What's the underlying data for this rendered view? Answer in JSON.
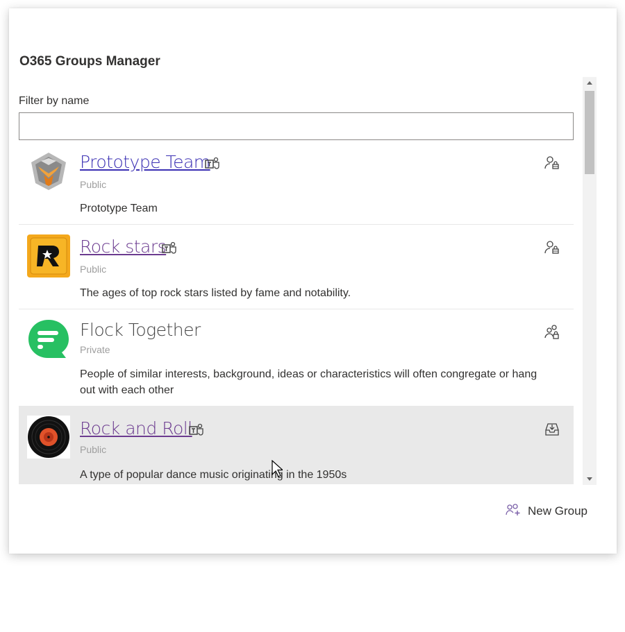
{
  "app": {
    "title": "O365 Groups Manager"
  },
  "filter": {
    "label": "Filter by name",
    "value": "",
    "placeholder": ""
  },
  "groups": [
    {
      "name": "Prototype Team",
      "privacy": "Public",
      "description": "Prototype Team",
      "is_team": true,
      "logo_icon": "prototype-logo-icon",
      "action_icon": "user-lock-icon"
    },
    {
      "name": "Rock stars",
      "privacy": "Public",
      "description": "The ages of top rock stars listed by fame and notability.",
      "is_team": true,
      "logo_icon": "rockstar-logo-icon",
      "action_icon": "user-lock-icon"
    },
    {
      "name": "Flock Together",
      "privacy": "Private",
      "description": "People of similar interests, background, ideas or characteristics will often congregate or hang out with each other",
      "is_team": false,
      "logo_icon": "flock-logo-icon",
      "action_icon": "group-lock-icon"
    },
    {
      "name": "Rock and Roll",
      "privacy": "Public",
      "description": "A type of popular dance music originating in the 1950s",
      "is_team": true,
      "logo_icon": "vinyl-record-icon",
      "action_icon": "inbox-download-icon"
    }
  ],
  "footer": {
    "new_group_label": "New Group",
    "new_group_icon": "add-group-icon"
  },
  "colors": {
    "link_unvisited": "#3a2fb3",
    "link_visited": "#6b3a8f",
    "hover_bg": "#e9e9e9",
    "new_group_icon": "#7a5fa8"
  }
}
